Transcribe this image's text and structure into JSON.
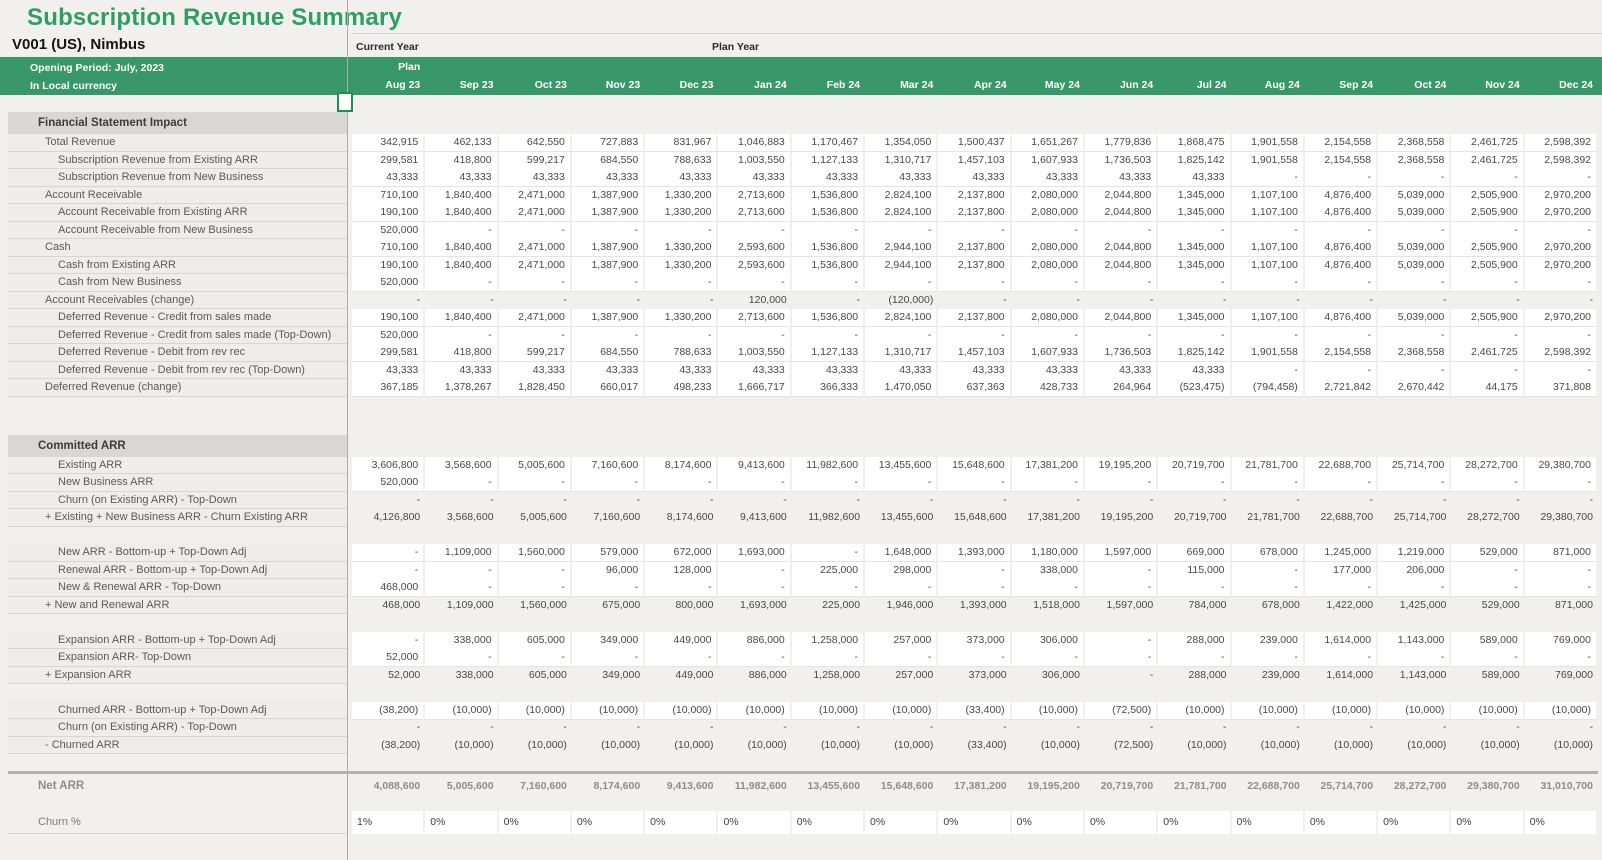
{
  "header": {
    "title": "Subscription Revenue Summary",
    "entity": "V001 (US), Nimbus",
    "opening_period": "Opening Period: July, 2023",
    "currency_note": "In Local currency",
    "current_year_label": "Current Year",
    "plan_year_label": "Plan Year",
    "plan_label": "Plan"
  },
  "colors": {
    "title_green": "#2f9e63",
    "band_green": "#38986a",
    "selection_green": "#1f8e4e",
    "section_header_bg": "#d8d7d5"
  },
  "columns": [
    "Aug 23",
    "Sep 23",
    "Oct 23",
    "Nov 23",
    "Dec 23",
    "Jan 24",
    "Feb 24",
    "Mar 24",
    "Apr 24",
    "May 24",
    "Jun 24",
    "Jul 24",
    "Aug 24",
    "Sep 24",
    "Oct 24",
    "Nov 24",
    "Dec 24"
  ],
  "sections": [
    {
      "title": "Financial Statement Impact",
      "rows": [
        {
          "label": "Total Revenue",
          "indent": 1,
          "style": "w",
          "values": [
            "342,915",
            "462,133",
            "642,550",
            "727,883",
            "831,967",
            "1,046,883",
            "1,170,467",
            "1,354,050",
            "1,500,437",
            "1,651,267",
            "1,779,836",
            "1,868,475",
            "1,901,558",
            "2,154,558",
            "2,368,558",
            "2,461,725",
            "2,598,392"
          ]
        },
        {
          "label": "Subscription Revenue from Existing ARR",
          "indent": 2,
          "style": "w",
          "values": [
            "299,581",
            "418,800",
            "599,217",
            "684,550",
            "788,633",
            "1,003,550",
            "1,127,133",
            "1,310,717",
            "1,457,103",
            "1,607,933",
            "1,736,503",
            "1,825,142",
            "1,901,558",
            "2,154,558",
            "2,368,558",
            "2,461,725",
            "2,598,392"
          ]
        },
        {
          "label": "Subscription Revenue from New Business",
          "indent": 2,
          "style": "w",
          "values": [
            "43,333",
            "43,333",
            "43,333",
            "43,333",
            "43,333",
            "43,333",
            "43,333",
            "43,333",
            "43,333",
            "43,333",
            "43,333",
            "43,333",
            "-",
            "-",
            "-",
            "-",
            "-"
          ]
        },
        {
          "label": "Account Receivable",
          "indent": 1,
          "style": "w",
          "values": [
            "710,100",
            "1,840,400",
            "2,471,000",
            "1,387,900",
            "1,330,200",
            "2,713,600",
            "1,536,800",
            "2,824,100",
            "2,137,800",
            "2,080,000",
            "2,044,800",
            "1,345,000",
            "1,107,100",
            "4,876,400",
            "5,039,000",
            "2,505,900",
            "2,970,200"
          ]
        },
        {
          "label": "Account Receivable from Existing ARR",
          "indent": 2,
          "style": "w",
          "values": [
            "190,100",
            "1,840,400",
            "2,471,000",
            "1,387,900",
            "1,330,200",
            "2,713,600",
            "1,536,800",
            "2,824,100",
            "2,137,800",
            "2,080,000",
            "2,044,800",
            "1,345,000",
            "1,107,100",
            "4,876,400",
            "5,039,000",
            "2,505,900",
            "2,970,200"
          ]
        },
        {
          "label": "Account Receivable from New Business",
          "indent": 2,
          "style": "w",
          "values": [
            "520,000",
            "-",
            "-",
            "-",
            "-",
            "-",
            "-",
            "-",
            "-",
            "-",
            "-",
            "-",
            "-",
            "-",
            "-",
            "-",
            "-"
          ]
        },
        {
          "label": "Cash",
          "indent": 1,
          "style": "w",
          "values": [
            "710,100",
            "1,840,400",
            "2,471,000",
            "1,387,900",
            "1,330,200",
            "2,593,600",
            "1,536,800",
            "2,944,100",
            "2,137,800",
            "2,080,000",
            "2,044,800",
            "1,345,000",
            "1,107,100",
            "4,876,400",
            "5,039,000",
            "2,505,900",
            "2,970,200"
          ]
        },
        {
          "label": "Cash from Existing ARR",
          "indent": 2,
          "style": "w",
          "values": [
            "190,100",
            "1,840,400",
            "2,471,000",
            "1,387,900",
            "1,330,200",
            "2,593,600",
            "1,536,800",
            "2,944,100",
            "2,137,800",
            "2,080,000",
            "2,044,800",
            "1,345,000",
            "1,107,100",
            "4,876,400",
            "5,039,000",
            "2,505,900",
            "2,970,200"
          ]
        },
        {
          "label": "Cash from New Business",
          "indent": 2,
          "style": "w",
          "values": [
            "520,000",
            "-",
            "-",
            "-",
            "-",
            "-",
            "-",
            "-",
            "-",
            "-",
            "-",
            "-",
            "-",
            "-",
            "-",
            "-",
            "-"
          ]
        },
        {
          "label": "Account Receivables (change)",
          "indent": 1,
          "style": "c",
          "values": [
            "-",
            "-",
            "-",
            "-",
            "-",
            "120,000",
            "-",
            "(120,000)",
            "-",
            "-",
            "-",
            "-",
            "-",
            "-",
            "-",
            "-",
            "-"
          ]
        },
        {
          "label": "Deferred Revenue - Credit from sales made",
          "indent": 2,
          "style": "w",
          "values": [
            "190,100",
            "1,840,400",
            "2,471,000",
            "1,387,900",
            "1,330,200",
            "2,713,600",
            "1,536,800",
            "2,824,100",
            "2,137,800",
            "2,080,000",
            "2,044,800",
            "1,345,000",
            "1,107,100",
            "4,876,400",
            "5,039,000",
            "2,505,900",
            "2,970,200"
          ]
        },
        {
          "label": "Deferred Revenue - Credit from sales made (Top-Down)",
          "indent": 2,
          "style": "w",
          "values": [
            "520,000",
            "-",
            "-",
            "-",
            "-",
            "-",
            "-",
            "-",
            "-",
            "-",
            "-",
            "-",
            "-",
            "-",
            "-",
            "-",
            "-"
          ]
        },
        {
          "label": "Deferred Revenue - Debit from rev rec",
          "indent": 2,
          "style": "w",
          "values": [
            "299,581",
            "418,800",
            "599,217",
            "684,550",
            "788,633",
            "1,003,550",
            "1,127,133",
            "1,310,717",
            "1,457,103",
            "1,607,933",
            "1,736,503",
            "1,825,142",
            "1,901,558",
            "2,154,558",
            "2,368,558",
            "2,461,725",
            "2,598,392"
          ]
        },
        {
          "label": "Deferred Revenue - Debit from rev rec (Top-Down)",
          "indent": 2,
          "style": "w",
          "values": [
            "43,333",
            "43,333",
            "43,333",
            "43,333",
            "43,333",
            "43,333",
            "43,333",
            "43,333",
            "43,333",
            "43,333",
            "43,333",
            "43,333",
            "-",
            "-",
            "-",
            "-",
            "-"
          ]
        },
        {
          "label": "Deferred Revenue (change)",
          "indent": 1,
          "style": "w",
          "values": [
            "367,185",
            "1,378,267",
            "1,828,450",
            "660,017",
            "498,233",
            "1,666,717",
            "366,333",
            "1,470,050",
            "637,363",
            "428,733",
            "264,964",
            "(523,475)",
            "(794,458)",
            "2,721,842",
            "2,670,442",
            "44,175",
            "371,808"
          ]
        }
      ]
    },
    {
      "title": "Committed ARR",
      "rows": [
        {
          "label": "Existing ARR",
          "indent": 2,
          "style": "w",
          "values": [
            "3,606,800",
            "3,568,600",
            "5,005,600",
            "7,160,600",
            "8,174,600",
            "9,413,600",
            "11,982,600",
            "13,455,600",
            "15,648,600",
            "17,381,200",
            "19,195,200",
            "20,719,700",
            "21,781,700",
            "22,688,700",
            "25,714,700",
            "28,272,700",
            "29,380,700"
          ]
        },
        {
          "label": "New Business ARR",
          "indent": 2,
          "style": "w",
          "values": [
            "520,000",
            "-",
            "-",
            "-",
            "-",
            "-",
            "-",
            "-",
            "-",
            "-",
            "-",
            "-",
            "-",
            "-",
            "-",
            "-",
            "-"
          ]
        },
        {
          "label": "Churn (on Existing ARR) - Top-Down",
          "indent": 2,
          "style": "c",
          "values": [
            "-",
            "-",
            "-",
            "-",
            "-",
            "-",
            "-",
            "-",
            "-",
            "-",
            "-",
            "-",
            "-",
            "-",
            "-",
            "-",
            "-"
          ]
        },
        {
          "label": "+ Existing + New Business ARR - Churn Existing ARR",
          "indent": 1,
          "style": "c",
          "values": [
            "4,126,800",
            "3,568,600",
            "5,005,600",
            "7,160,600",
            "8,174,600",
            "9,413,600",
            "11,982,600",
            "13,455,600",
            "15,648,600",
            "17,381,200",
            "19,195,200",
            "20,719,700",
            "21,781,700",
            "22,688,700",
            "25,714,700",
            "28,272,700",
            "29,380,700"
          ]
        },
        {
          "spacer": true
        },
        {
          "label": "New ARR - Bottom-up + Top-Down Adj",
          "indent": 2,
          "style": "w",
          "values": [
            "-",
            "1,109,000",
            "1,560,000",
            "579,000",
            "672,000",
            "1,693,000",
            "-",
            "1,648,000",
            "1,393,000",
            "1,180,000",
            "1,597,000",
            "669,000",
            "678,000",
            "1,245,000",
            "1,219,000",
            "529,000",
            "871,000"
          ]
        },
        {
          "label": "Renewal ARR - Bottom-up + Top-Down Adj",
          "indent": 2,
          "style": "w",
          "values": [
            "-",
            "-",
            "-",
            "96,000",
            "128,000",
            "-",
            "225,000",
            "298,000",
            "-",
            "338,000",
            "-",
            "115,000",
            "-",
            "177,000",
            "206,000",
            "-",
            "-"
          ]
        },
        {
          "label": "New & Renewal ARR - Top-Down",
          "indent": 2,
          "style": "w",
          "values": [
            "468,000",
            "-",
            "-",
            "-",
            "-",
            "-",
            "-",
            "-",
            "-",
            "-",
            "-",
            "-",
            "-",
            "-",
            "-",
            "-",
            "-"
          ]
        },
        {
          "label": "+ New and Renewal ARR",
          "indent": 1,
          "style": "c",
          "values": [
            "468,000",
            "1,109,000",
            "1,560,000",
            "675,000",
            "800,000",
            "1,693,000",
            "225,000",
            "1,946,000",
            "1,393,000",
            "1,518,000",
            "1,597,000",
            "784,000",
            "678,000",
            "1,422,000",
            "1,425,000",
            "529,000",
            "871,000"
          ]
        },
        {
          "spacer": true
        },
        {
          "label": "Expansion ARR - Bottom-up + Top-Down Adj",
          "indent": 2,
          "style": "w",
          "values": [
            "-",
            "338,000",
            "605,000",
            "349,000",
            "449,000",
            "886,000",
            "1,258,000",
            "257,000",
            "373,000",
            "306,000",
            "-",
            "288,000",
            "239,000",
            "1,614,000",
            "1,143,000",
            "589,000",
            "769,000"
          ]
        },
        {
          "label": "Expansion ARR- Top-Down",
          "indent": 2,
          "style": "w",
          "values": [
            "52,000",
            "-",
            "-",
            "-",
            "-",
            "-",
            "-",
            "-",
            "-",
            "-",
            "-",
            "-",
            "-",
            "-",
            "-",
            "-",
            "-"
          ]
        },
        {
          "label": "+ Expansion ARR",
          "indent": 1,
          "style": "c",
          "values": [
            "52,000",
            "338,000",
            "605,000",
            "349,000",
            "449,000",
            "886,000",
            "1,258,000",
            "257,000",
            "373,000",
            "306,000",
            "-",
            "288,000",
            "239,000",
            "1,614,000",
            "1,143,000",
            "589,000",
            "769,000"
          ]
        },
        {
          "spacer": true
        },
        {
          "label": "Churned ARR - Bottom-up + Top-Down Adj",
          "indent": 2,
          "style": "w",
          "values": [
            "(38,200)",
            "(10,000)",
            "(10,000)",
            "(10,000)",
            "(10,000)",
            "(10,000)",
            "(10,000)",
            "(10,000)",
            "(33,400)",
            "(10,000)",
            "(72,500)",
            "(10,000)",
            "(10,000)",
            "(10,000)",
            "(10,000)",
            "(10,000)",
            "(10,000)"
          ]
        },
        {
          "label": "Churn (on Existing ARR) - Top-Down",
          "indent": 2,
          "style": "c",
          "values": [
            "-",
            "-",
            "-",
            "-",
            "-",
            "-",
            "-",
            "-",
            "-",
            "-",
            "-",
            "-",
            "-",
            "-",
            "-",
            "-",
            "-"
          ]
        },
        {
          "label": "- Churned ARR",
          "indent": 1,
          "style": "c",
          "values": [
            "(38,200)",
            "(10,000)",
            "(10,000)",
            "(10,000)",
            "(10,000)",
            "(10,000)",
            "(10,000)",
            "(10,000)",
            "(33,400)",
            "(10,000)",
            "(72,500)",
            "(10,000)",
            "(10,000)",
            "(10,000)",
            "(10,000)",
            "(10,000)",
            "(10,000)"
          ]
        }
      ]
    }
  ],
  "totals": {
    "net_arr_label": "Net ARR",
    "net_arr_values": [
      "4,088,600",
      "5,005,600",
      "7,160,600",
      "8,174,600",
      "9,413,600",
      "11,982,600",
      "13,455,600",
      "15,648,600",
      "17,381,200",
      "19,195,200",
      "20,719,700",
      "21,781,700",
      "22,688,700",
      "25,714,700",
      "28,272,700",
      "29,380,700",
      "31,010,700"
    ],
    "churn_label": "Churn %",
    "churn_values": [
      "1%",
      "0%",
      "0%",
      "0%",
      "0%",
      "0%",
      "0%",
      "0%",
      "0%",
      "0%",
      "0%",
      "0%",
      "0%",
      "0%",
      "0%",
      "0%",
      "0%"
    ]
  }
}
